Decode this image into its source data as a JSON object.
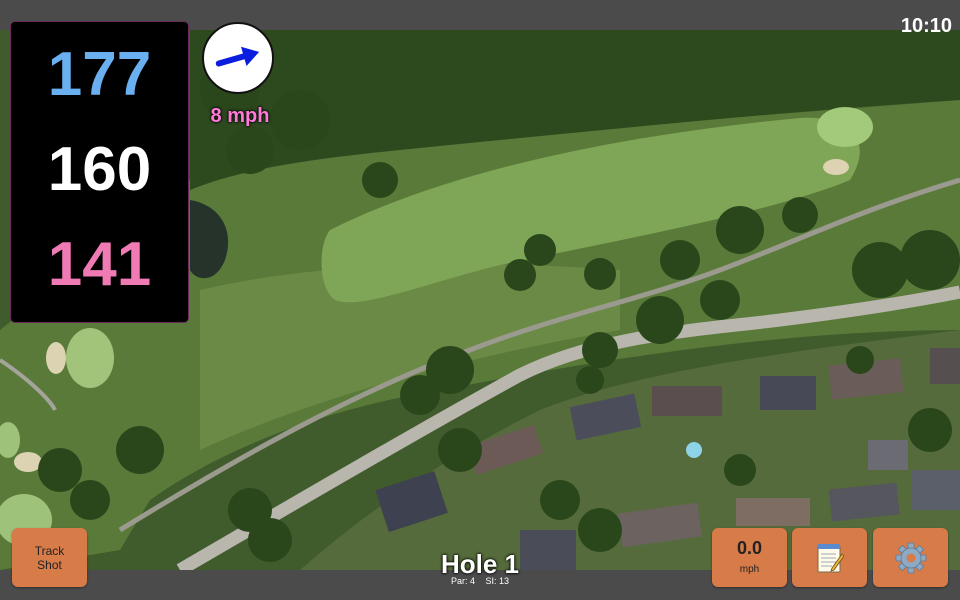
{
  "status": {
    "time": "10:10"
  },
  "distances": {
    "back": "177",
    "middle": "160",
    "front": "141"
  },
  "wind": {
    "speed": "8 mph",
    "direction_icon": "arrow-right-icon"
  },
  "hole": {
    "title": "Hole 1",
    "par": "Par: 4",
    "stroke_index": "SI: 13"
  },
  "buttons": {
    "track_shot": {
      "line1": "Track",
      "line2": "Shot"
    },
    "speed": {
      "value": "0.0",
      "unit": "mph"
    },
    "notes_icon": "notepad-icon",
    "settings_icon": "gear-icon"
  },
  "colors": {
    "back_distance": "#6aaff0",
    "middle_distance": "#ffffff",
    "front_distance": "#f07ab4",
    "wind_text": "#ff7ad8",
    "button": "#d77b48"
  }
}
